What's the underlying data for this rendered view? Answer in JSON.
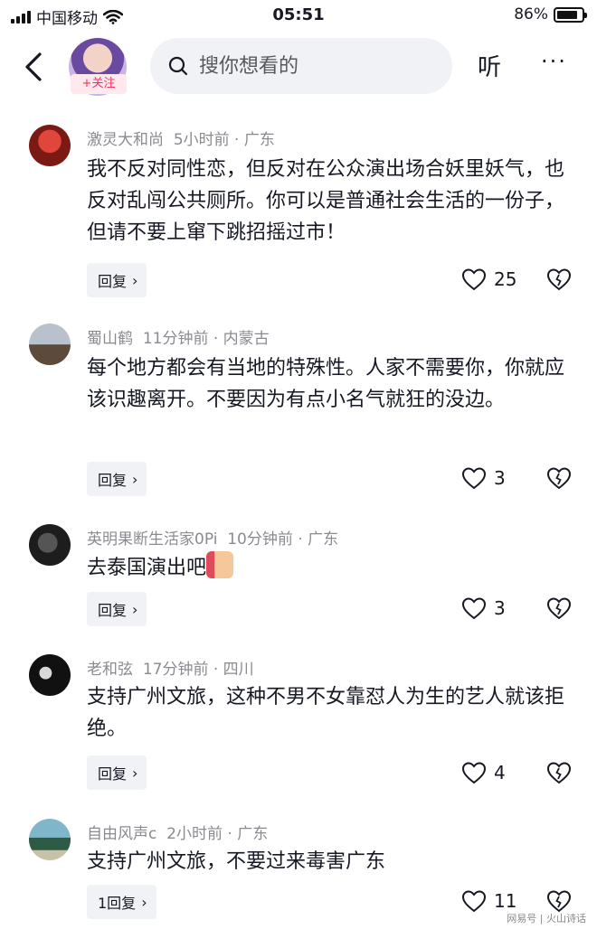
{
  "status_bar": {
    "carrier": "中国移动",
    "time": "05:51",
    "battery": "86%",
    "battery_level": 0.86
  },
  "nav": {
    "follow_label": "+关注",
    "search_placeholder": "搜你想看的",
    "listen_label": "听",
    "more_label": "···"
  },
  "comments": [
    {
      "author": "激灵大和尚",
      "time": "5小时前",
      "location": "广东",
      "text": "我不反对同性恋，但反对在公众演出场合妖里妖气，也反对乱闯公共厕所。你可以是普通社会生活的一份子，但请不要上窜下跳招摇过市！",
      "reply_label": "回复",
      "likes": "25"
    },
    {
      "author": "蜀山鹤",
      "time": "11分钟前",
      "location": "内蒙古",
      "text": "每个地方都会有当地的特殊性。人家不需要你，你就应该识趣离开。不要因为有点小名气就狂的没边。",
      "reply_label": "回复",
      "likes": "3"
    },
    {
      "author": "英明果断生活家0Pi",
      "time": "10分钟前",
      "location": "广东",
      "text": "去泰国演出吧",
      "reply_label": "回复",
      "likes": "3"
    },
    {
      "author": "老和弦",
      "time": "17分钟前",
      "location": "四川",
      "text": "支持广州文旅，这种不男不女靠怼人为生的艺人就该拒绝。",
      "reply_label": "回复",
      "likes": "4"
    },
    {
      "author": "自由风声c",
      "time": "2小时前",
      "location": "广东",
      "text": "支持广州文旅，不要过来毒害广东",
      "reply_label": "1回复",
      "likes": "11"
    }
  ],
  "watermark": "网易号 | 火山诗话"
}
